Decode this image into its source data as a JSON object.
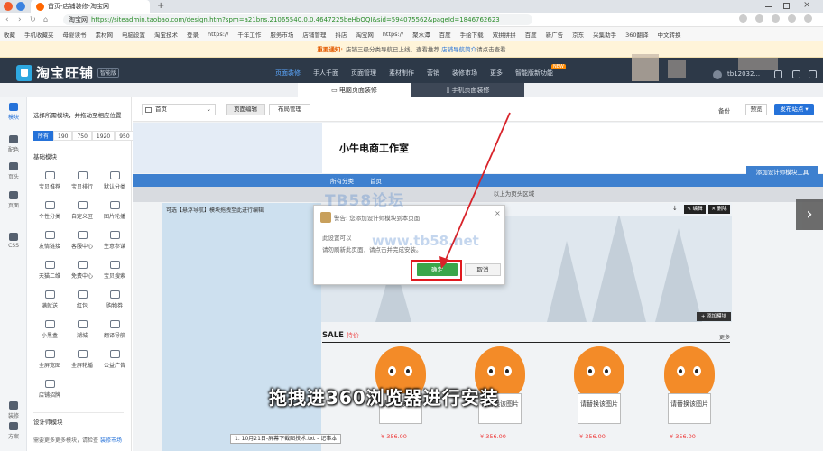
{
  "browser": {
    "tab_title": "首页-店铺装修-淘宝网",
    "add_tab": "+",
    "url_site": "淘宝网",
    "url": "https://siteadmin.taobao.com/design.htm?spm=a21bns.21065540.0.0.4647225beHbOQI&sid=594075562&pageId=1846762623",
    "bookmarks": [
      "收藏",
      "手机收藏夹",
      "母婴读书",
      "素材网",
      "电脑设置",
      "淘宝技术",
      "登录",
      "https://",
      "千年工作",
      "服务市场",
      "店铺管理",
      "抖店",
      "淘宝网",
      "https://",
      "聚水潭",
      "百度",
      "手绘下载",
      "双拼拼拼",
      "百度",
      "新广告",
      "京东",
      "采集助手",
      "360翻译",
      "中文转换"
    ]
  },
  "notice": {
    "label": "重要通知:",
    "text": "店铺三级分类导航已上线，查看推荐",
    "link_text": "店铺导航简介",
    "suffix": "请点击查看"
  },
  "app": {
    "logo": "淘宝旺铺",
    "version": "智能版",
    "nav": [
      "页面装修",
      "手人千面",
      "页面管理",
      "素材制作",
      "营销",
      "装修市场",
      "更多",
      "智能版新功能"
    ],
    "new_badge": "NEW",
    "user": "tb12032..."
  },
  "modes": {
    "pc": "电脑页面装修",
    "mobile": "手机页面装修"
  },
  "rail": [
    {
      "label": "模块"
    },
    {
      "label": "配色"
    },
    {
      "label": "页头"
    },
    {
      "label": "页面"
    },
    {
      "label": "CSS"
    },
    {
      "label": "装修"
    },
    {
      "label": "方案"
    }
  ],
  "panel": {
    "title": "选择所需模块，并拖动至相应位置",
    "widths": [
      "所有",
      "190",
      "750",
      "1920",
      "950"
    ],
    "basic_section": "基础模块",
    "modules": [
      "宝贝推荐",
      "宝贝排行",
      "默认分类",
      "个性分类",
      "自定义区",
      "图片轮播",
      "友情链接",
      "客服中心",
      "生意参谋",
      "天猫二维",
      "免费中心",
      "宝贝搜索",
      "满就送",
      "红包",
      "购物券",
      "小黑盒",
      "潮城",
      "翻译导航",
      "全屏宽图",
      "全屏轮播",
      "公益广告",
      "店铺招牌"
    ],
    "design_section": "设计师模块",
    "footer": "需要更多更多模块，请检查",
    "footer_link": "装修市场"
  },
  "toolbar": {
    "page": "首页",
    "layout_edit": "页面编辑",
    "layout_manage": "布局管理",
    "backup": "备份",
    "preview": "预览",
    "publish": "发布站点"
  },
  "shop": {
    "name": "小牛电商工作室",
    "nav": [
      "所有分类",
      "首页"
    ],
    "add_tool": "添加设计师模块工具",
    "above_label": "以上为页头区域",
    "left_module_title": "可选【悬浮导航】模块拖拽至此进行编辑",
    "edit_btn": "编辑",
    "delete_btn": "删除",
    "add_module_btn": "+ 添加模块",
    "sale_en": "SALE",
    "sale_cn": "特价",
    "more": "更多",
    "product_sign": "请替换该图片",
    "price": "¥ 356.00"
  },
  "dialog": {
    "title": "警告: 您添加设计师模块到本页面",
    "line1": "此设置可以",
    "line2": "请勿刷新此页面，请点击并完成安装。",
    "ok": "确定",
    "cancel": "取消",
    "close": "×"
  },
  "watermark": {
    "line1": "TB58论坛",
    "line2": "www.tb58.net"
  },
  "subtitle": "拖拽进360浏览器进行安装",
  "tooltip": "1. 10月21日-屏幕下截图技术.txt - 记事本",
  "next_arrow": "›",
  "colors": {
    "accent": "#2572d9",
    "header": "#2d3948",
    "ok": "#3aa64a",
    "highlight": "#e0191e",
    "arrow": "#d8232a"
  }
}
